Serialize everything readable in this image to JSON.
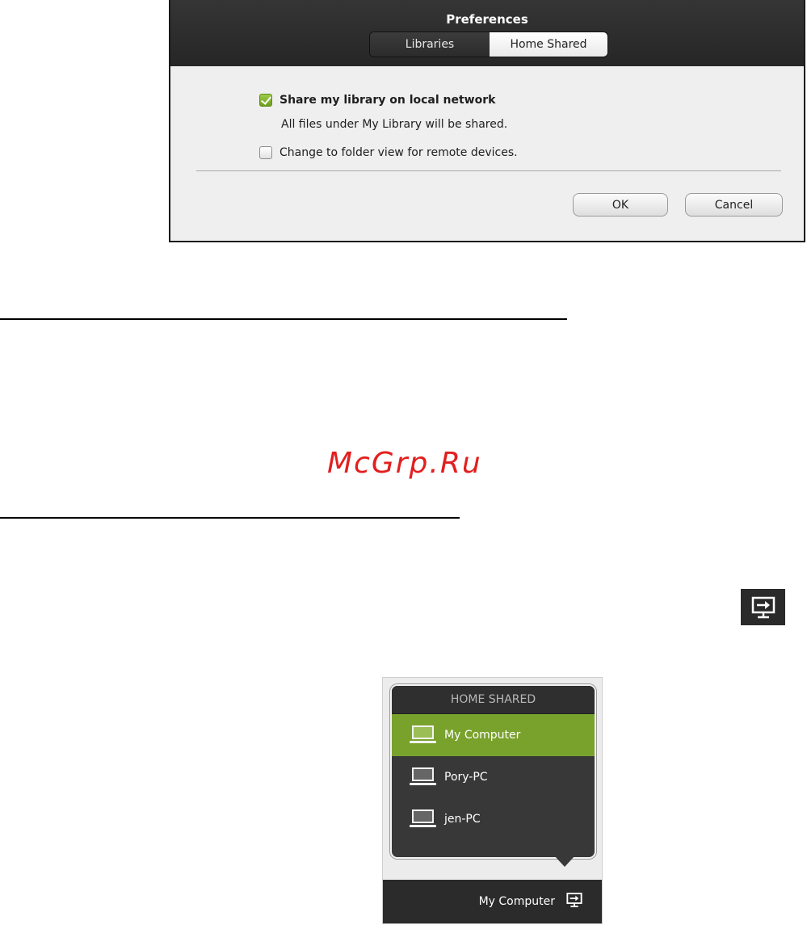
{
  "preferences": {
    "title": "Preferences",
    "tabs": [
      {
        "label": "Libraries",
        "active": false
      },
      {
        "label": "Home Shared",
        "active": true
      }
    ],
    "share_option": {
      "label": "Share my library on local network",
      "checked": true
    },
    "share_note": "All files under My Library will be shared.",
    "folder_view_option": {
      "label": "Change to folder view for remote devices.",
      "checked": false
    },
    "ok_label": "OK",
    "cancel_label": "Cancel"
  },
  "watermark": "McGrp.Ru",
  "home_shared_menu": {
    "header": "HOME SHARED",
    "items": [
      {
        "label": "My Computer",
        "selected": true
      },
      {
        "label": "Pory-PC",
        "selected": false
      },
      {
        "label": "jen-PC",
        "selected": false
      }
    ],
    "footer_label": "My Computer"
  },
  "icons": {
    "home_shared": "home-shared-icon",
    "computer": "laptop-icon"
  },
  "colors": {
    "accent_green": "#79a22c",
    "dark_bar": "#2b2b2b",
    "watermark_red": "#e21f1f"
  }
}
